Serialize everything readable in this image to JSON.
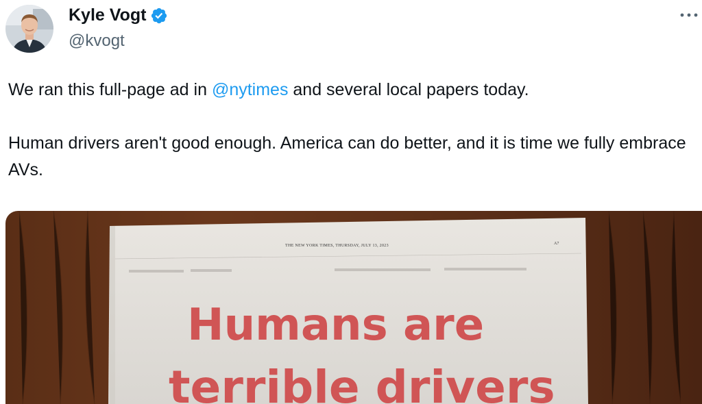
{
  "tweet": {
    "author": {
      "display_name": "Kyle Vogt",
      "handle": "@kvogt",
      "verified": true
    },
    "text": {
      "paragraph1_before": "We ran this full-page ad in ",
      "mention": "@nytimes",
      "paragraph1_after": " and several local papers today.",
      "paragraph2": "Human drivers aren't good enough. America can do better, and it is time we fully embrace AVs."
    },
    "media": {
      "newspaper_header": "THE NEW YORK TIMES, THURSDAY, JULY 13, 2023",
      "page_number": "A7",
      "headline_line1": "Humans are",
      "headline_line2": "terrible drivers"
    }
  },
  "icons": {
    "verified": "verified-badge-icon",
    "more": "more-options-icon"
  },
  "colors": {
    "accent": "#1d9bf0",
    "text": "#0f1419",
    "secondary": "#536471",
    "headline": "#d05555"
  }
}
